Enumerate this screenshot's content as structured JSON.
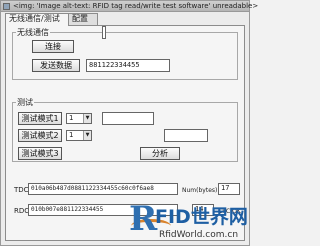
{
  "window": {
    "title": "<img: 'Image alt-text: RFID tag read/write test software' unreadable>"
  },
  "tabs": [
    {
      "label": "无线通信/测试"
    },
    {
      "label": "配置"
    }
  ],
  "wireless": {
    "group_label": "无线通信",
    "connect_button": "连接",
    "send_button": "发送数据",
    "send_value": "881122334455"
  },
  "test": {
    "group_label": "测试",
    "mode1_button": "测试模式1",
    "mode1_select": "1",
    "mode2_button": "测试模式2",
    "mode2_select": "1",
    "mode3_button": "测试模式3",
    "analyze_button": "分析"
  },
  "io": {
    "tdc_label": "TDC",
    "tdc_value": "010a06b487d0881122334455c60c0f6ae8",
    "num_label": "Num(bytes):",
    "num_value": "17",
    "rdc_label": "RDC",
    "rdc_value": "010b007e881122334455",
    "rdc_count": "14",
    "crc_label": "CRC OK"
  },
  "watermark": {
    "letter": "R",
    "brand": "FID世界网",
    "url": "RfidWorld.com.cn"
  }
}
